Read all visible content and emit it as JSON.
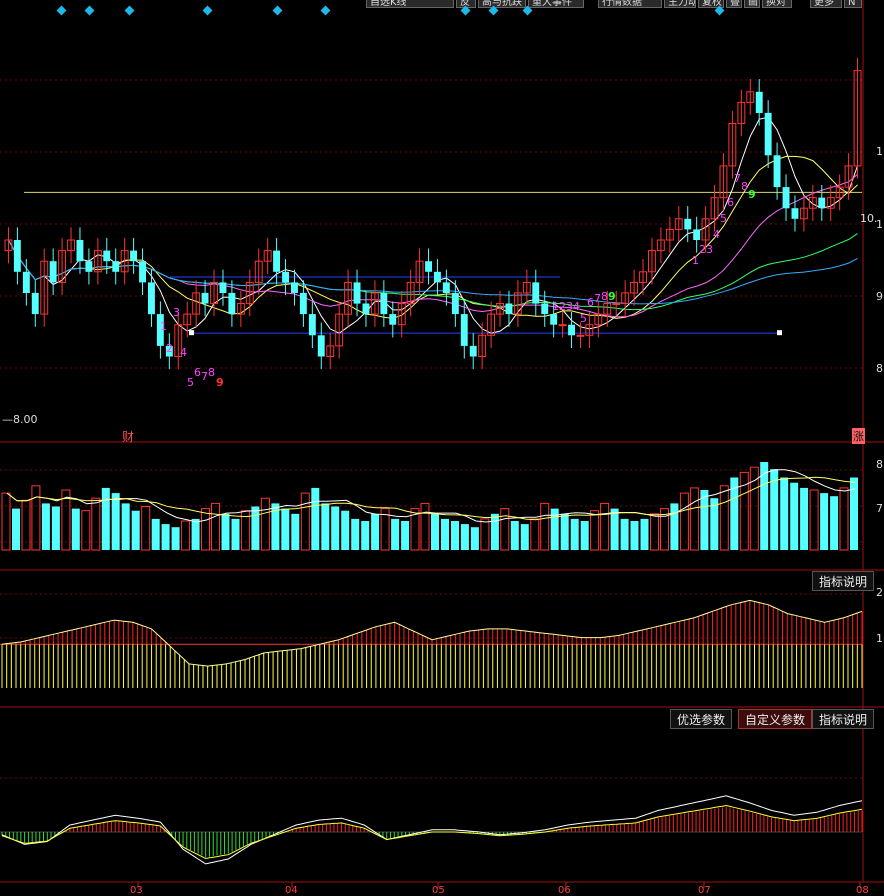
{
  "toolbar": {
    "items": [
      "自选K线",
      "反",
      "高与抗跌",
      "重大事件",
      "行情数据",
      "主力动线",
      "复权",
      "叠",
      "画",
      "换对",
      "更多",
      "N"
    ]
  },
  "price_panel": {
    "low_label": "8.00",
    "left_marker": "财",
    "right_marker": "涨",
    "right_value": "10.",
    "axis_right": [
      "1",
      "1",
      "9",
      "8"
    ],
    "td_labels_down": [
      "1",
      "2",
      "3",
      "4",
      "5",
      "6",
      "7",
      "8",
      "9"
    ],
    "td_labels_up": [
      "1",
      "2",
      "3",
      "4",
      "5",
      "6",
      "7",
      "8",
      "9"
    ]
  },
  "volume_panel": {
    "axis_right": [
      "8",
      "7"
    ]
  },
  "indicator1": {
    "explain_button": "指标说明",
    "axis_right": [
      "2",
      "1"
    ]
  },
  "indicator2": {
    "buttons": [
      "优选参数",
      "自定义参数",
      "指标说明"
    ],
    "selected": "自定义参数"
  },
  "x_axis": {
    "labels": [
      "03",
      "04",
      "05",
      "06",
      "07",
      "08"
    ]
  },
  "colors": {
    "up": "#ff3232",
    "down": "#54ffff",
    "panel_line": "#a01010",
    "grid": "#6a0a0a",
    "ma5": "#ffffff",
    "ma10": "#ffff66",
    "ma20": "#ff66ff",
    "ma60": "#33ff66",
    "ma120": "#33aaff",
    "accent": "#1fb6e8"
  },
  "chart_data": {
    "type": "candlestick",
    "ylim": [
      8.0,
      11.4
    ],
    "low_reference": 8.0,
    "candles_close": [
      9.7,
      9.4,
      9.2,
      9.0,
      9.5,
      9.3,
      9.6,
      9.7,
      9.5,
      9.4,
      9.6,
      9.5,
      9.4,
      9.6,
      9.5,
      9.3,
      9.0,
      8.7,
      8.6,
      8.9,
      9.0,
      9.2,
      9.1,
      9.3,
      9.2,
      9.0,
      9.1,
      9.3,
      9.5,
      9.6,
      9.4,
      9.3,
      9.2,
      9.0,
      8.8,
      8.6,
      8.7,
      9.0,
      9.3,
      9.1,
      9.0,
      9.2,
      9.0,
      8.9,
      9.1,
      9.3,
      9.5,
      9.4,
      9.3,
      9.2,
      9.0,
      8.7,
      8.6,
      8.8,
      9.0,
      9.1,
      9.0,
      9.2,
      9.3,
      9.1,
      9.0,
      8.9,
      8.9,
      8.8,
      8.8,
      8.9,
      9.0,
      9.1,
      9.1,
      9.2,
      9.3,
      9.4,
      9.6,
      9.7,
      9.8,
      9.9,
      9.8,
      9.7,
      9.9,
      10.1,
      10.4,
      10.8,
      11.0,
      11.1,
      10.9,
      10.5,
      10.2,
      10.0,
      9.9,
      10.0,
      10.1,
      10.0,
      10.1,
      10.2,
      10.4,
      11.3
    ],
    "volume": [
      55,
      40,
      48,
      62,
      45,
      42,
      58,
      40,
      38,
      50,
      60,
      55,
      45,
      38,
      42,
      30,
      25,
      22,
      28,
      30,
      40,
      45,
      35,
      30,
      38,
      42,
      50,
      45,
      40,
      35,
      55,
      60,
      45,
      42,
      38,
      30,
      28,
      35,
      40,
      30,
      28,
      40,
      45,
      35,
      30,
      28,
      25,
      22,
      30,
      35,
      40,
      28,
      25,
      30,
      45,
      40,
      35,
      30,
      28,
      38,
      45,
      40,
      30,
      28,
      30,
      35,
      40,
      45,
      55,
      60,
      58,
      50,
      62,
      70,
      75,
      80,
      85,
      78,
      70,
      65,
      60,
      58,
      55,
      52,
      60,
      70
    ],
    "indicator1": [
      1.0,
      1.05,
      1.15,
      1.25,
      1.35,
      1.45,
      1.55,
      1.5,
      1.35,
      0.95,
      0.55,
      0.5,
      0.55,
      0.65,
      0.8,
      0.85,
      0.9,
      1.0,
      1.1,
      1.25,
      1.4,
      1.5,
      1.3,
      1.1,
      1.2,
      1.3,
      1.35,
      1.35,
      1.3,
      1.25,
      1.2,
      1.15,
      1.15,
      1.2,
      1.3,
      1.4,
      1.5,
      1.6,
      1.75,
      1.9,
      2.0,
      1.9,
      1.7,
      1.6,
      1.5,
      1.6,
      1.75
    ],
    "indicator2": [
      -0.05,
      -0.15,
      -0.12,
      0.05,
      0.1,
      0.15,
      0.12,
      0.08,
      -0.2,
      -0.35,
      -0.3,
      -0.15,
      -0.05,
      0.05,
      0.1,
      0.12,
      0.05,
      -0.1,
      -0.05,
      0.0,
      0.0,
      -0.02,
      -0.05,
      -0.03,
      0.0,
      0.05,
      0.08,
      0.1,
      0.12,
      0.2,
      0.25,
      0.3,
      0.35,
      0.28,
      0.2,
      0.15,
      0.18,
      0.25,
      0.3
    ]
  }
}
